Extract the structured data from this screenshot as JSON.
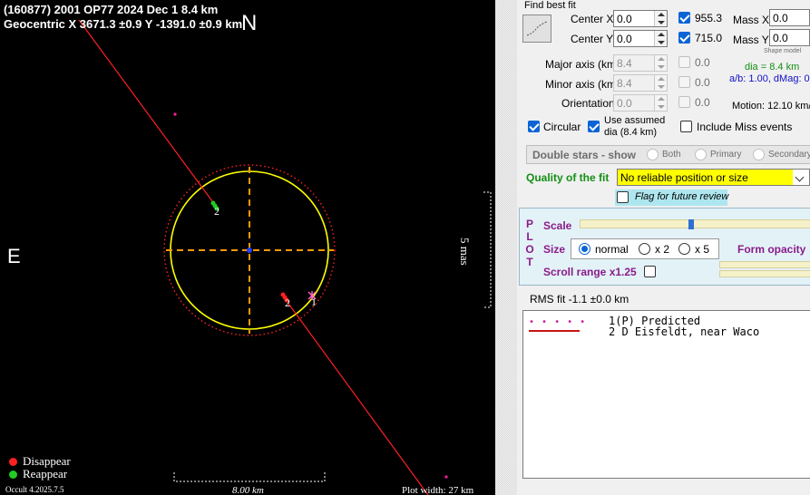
{
  "plot": {
    "title": "(160877) 2001 OP77  2024 Dec 1   8.4 km",
    "geocentric": "Geocentric  X  3671.3 ±0.9  Y -1391.0 ±0.9 km",
    "north_label": "N",
    "east_label": "E",
    "scale_label": "5 mas",
    "legend": {
      "disappear": "Disappear",
      "reappear": "Reappear"
    },
    "version": "Occult 4.2025.7.5",
    "scale_bar_label": "8.00 km",
    "plot_width": "Plot width: 27 km",
    "chord_labels": {
      "predicted": "1",
      "observer_reappear": "2",
      "observer_disappear": "2"
    },
    "colors": {
      "ellipse": "#ffff00",
      "chord": "#ff2020",
      "axes": "#ff9900",
      "predicted": "#ff1aa0",
      "disappear": "#ff2020",
      "reappear": "#22cc22",
      "center": "#2040ff"
    }
  },
  "panel": {
    "find_best_fit": "Find best fit",
    "center_x": {
      "label": "Center X",
      "value": "0.0",
      "check_value": "955.3"
    },
    "center_y": {
      "label": "Center Y",
      "value": "0.0",
      "check_value": "715.0"
    },
    "mass_x": {
      "label": "Mass X",
      "value": "0.0"
    },
    "mass_y": {
      "label": "Mass Y",
      "value": "0.0"
    },
    "shape_model": "Shape model",
    "major_axis": {
      "label": "Major axis (km)",
      "value": "8.4",
      "check_value": "0.0"
    },
    "minor_axis": {
      "label": "Minor axis (km)",
      "value": "8.4",
      "check_value": "0.0"
    },
    "orientation": {
      "label": "Orientation",
      "value": "0.0",
      "check_value": "0.0"
    },
    "dia": "dia = 8.4 km",
    "ab": "a/b: 1.00, dMag: 0.",
    "motion": "Motion: 12.10 km/",
    "circular": "Circular",
    "use_assumed": "Use assumed",
    "use_assumed_dia": "dia (8.4 km)",
    "include_miss": "Include Miss events",
    "double_stars": {
      "label": "Double stars - show",
      "both": "Both",
      "primary": "Primary",
      "secondary": "Secondary"
    },
    "quality_label": "Quality of the fit",
    "quality_value": "No reliable position or size",
    "flag_review": "Flag for future review",
    "plot_group": {
      "side_label": [
        "P",
        "L",
        "O",
        "T"
      ],
      "scale": "Scale",
      "scale_fraction": 0.47,
      "size": "Size",
      "size_normal": "normal",
      "size_x2": "x 2",
      "size_x5": "x 5",
      "form_opacity": "Form opacity",
      "scroll_range": "Scroll range x1.25"
    },
    "rms_fit": "RMS fit -1.1 ±0.0 km",
    "list": [
      {
        "marker": "• • • • •",
        "text": "1(P)  Predicted"
      },
      {
        "marker": "",
        "text": "2     D Eisfeldt, near Waco"
      }
    ]
  }
}
